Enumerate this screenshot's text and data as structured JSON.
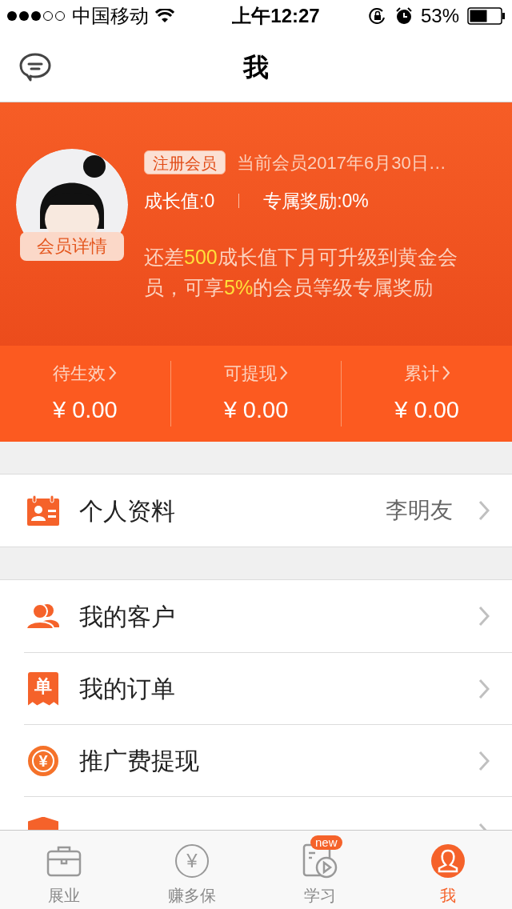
{
  "status_bar": {
    "carrier": "中国移动",
    "time": "上午12:27",
    "battery": "53%"
  },
  "nav": {
    "title": "我"
  },
  "profile": {
    "detail_button": "会员详情",
    "badge": "注册会员",
    "membership": "当前会员2017年6月30日…",
    "growth": "成长值:0",
    "reward": "专属奖励:0%",
    "upgrade_note": "还差**500**成长值下月可升级到黄金会员，可享**5%**的会员等级专属奖励"
  },
  "stats": [
    {
      "label": "待生效",
      "value": "¥ 0.00"
    },
    {
      "label": "可提现",
      "value": "¥ 0.00"
    },
    {
      "label": "累计",
      "value": "¥ 0.00"
    }
  ],
  "sections": [
    [
      {
        "kind": "id_card",
        "label": "个人资料",
        "value": "李明友"
      }
    ],
    [
      {
        "kind": "users",
        "label": "我的客户"
      },
      {
        "kind": "order",
        "label": "我的订单",
        "icon_text": "单"
      },
      {
        "kind": "exchange",
        "label": "推广费提现",
        "icon_text": "¥"
      },
      {
        "kind": "shield"
      }
    ]
  ],
  "tabs": [
    {
      "kind": "briefcase",
      "label": "展业",
      "selected": false
    },
    {
      "kind": "coin",
      "label": "赚多保",
      "icon_text": "¥",
      "selected": false
    },
    {
      "kind": "video",
      "label": "学习",
      "badge": "new",
      "selected": false
    },
    {
      "kind": "person",
      "label": "我",
      "selected": true
    }
  ]
}
